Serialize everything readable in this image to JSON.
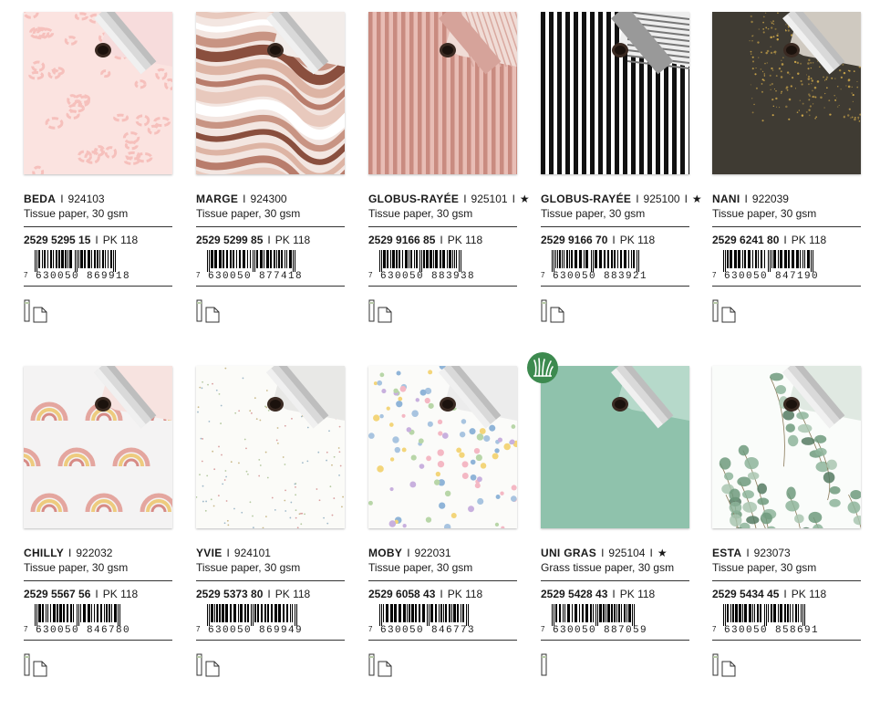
{
  "products": [
    {
      "name": "BEDA",
      "article": "924103",
      "star": false,
      "desc": "Tissue paper, 30 gsm",
      "code": "2529 5295 15",
      "pack": "PK 118",
      "ean_lead": "7",
      "ean": "630050 869918",
      "pattern": "leopard"
    },
    {
      "name": "MARGE",
      "article": "924300",
      "star": false,
      "desc": "Tissue paper, 30 gsm",
      "code": "2529 5299 85",
      "pack": "PK 118",
      "ean_lead": "7",
      "ean": "630050 877418",
      "pattern": "marble"
    },
    {
      "name": "GLOBUS-RAYÉE",
      "article": "925101",
      "star": true,
      "desc": "Tissue paper, 30 gsm",
      "code": "2529 9166 85",
      "pack": "PK 118",
      "ean_lead": "7",
      "ean": "630050 883938",
      "pattern": "rose-stripes"
    },
    {
      "name": "GLOBUS-RAYÉE",
      "article": "925100",
      "star": true,
      "desc": "Tissue paper, 30 gsm",
      "code": "2529 9166 70",
      "pack": "PK 118",
      "ean_lead": "7",
      "ean": "630050 883921",
      "pattern": "black-stripes"
    },
    {
      "name": "NANI",
      "article": "922039",
      "star": false,
      "desc": "Tissue paper, 30 gsm",
      "code": "2529 6241 80",
      "pack": "PK 118",
      "ean_lead": "7",
      "ean": "630050 847190",
      "pattern": "gold-dust"
    },
    {
      "name": "CHILLY",
      "article": "922032",
      "star": false,
      "desc": "Tissue paper, 30 gsm",
      "code": "2529 5567 56",
      "pack": "PK 118",
      "ean_lead": "7",
      "ean": "630050 846780",
      "pattern": "rainbows"
    },
    {
      "name": "YVIE",
      "article": "924101",
      "star": false,
      "desc": "Tissue paper, 30 gsm",
      "code": "2529 5373 80",
      "pack": "PK 118",
      "ean_lead": "7",
      "ean": "630050 869949",
      "pattern": "speckles"
    },
    {
      "name": "MOBY",
      "article": "922031",
      "star": false,
      "desc": "Tissue paper, 30 gsm",
      "code": "2529 6058 43",
      "pack": "PK 118",
      "ean_lead": "7",
      "ean": "630050 846773",
      "pattern": "confetti"
    },
    {
      "name": "UNI GRAS",
      "article": "925104",
      "star": true,
      "desc": "Grass tissue paper, 30 gsm",
      "code": "2529 5428 43",
      "pack": "PK 118",
      "ean_lead": "7",
      "ean": "630050 887059",
      "pattern": "mint",
      "badge": "grass-badge-icon",
      "no_sheet_icon": true
    },
    {
      "name": "ESTA",
      "article": "923073",
      "star": false,
      "desc": "Tissue paper, 30 gsm",
      "code": "2529 5434 45",
      "pack": "PK 118",
      "ean_lead": "7",
      "ean": "630050 858691",
      "pattern": "eucalyptus"
    }
  ],
  "labels": {
    "separator": "I",
    "star": "★"
  },
  "icons": [
    "roll-icon",
    "sheet-icon",
    "grass-badge-icon",
    "barcode-icon"
  ]
}
